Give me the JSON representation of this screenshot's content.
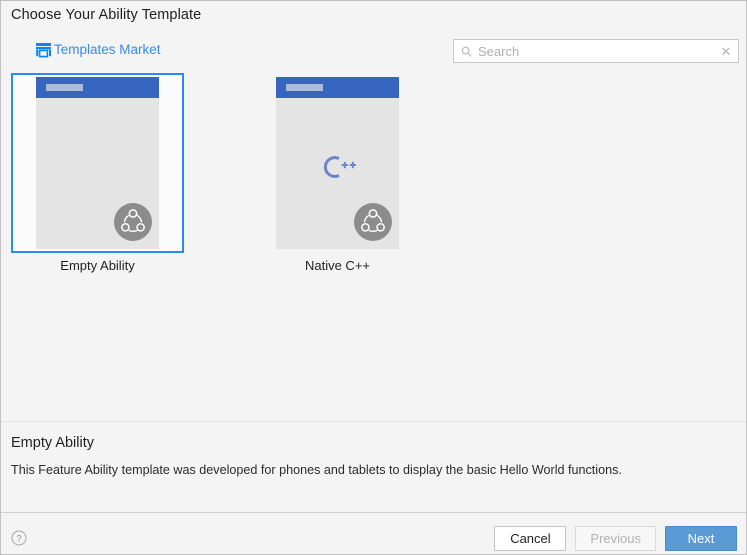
{
  "header": {
    "title": "Choose Your Ability Template",
    "templates_market_label": "Templates Market",
    "templates_market_icon": "storefront-icon"
  },
  "search": {
    "placeholder": "Search",
    "value": "",
    "search_icon": "search-icon",
    "clear_icon": "close-icon",
    "clear_glyph": "✕"
  },
  "templates": [
    {
      "label": "Empty Ability",
      "selected": true,
      "logo": "none",
      "badge_icon": "ability-badge-icon"
    },
    {
      "label": "Native C++",
      "selected": false,
      "logo": "cpp-logo",
      "badge_icon": "ability-badge-icon"
    }
  ],
  "description": {
    "title": "Empty Ability",
    "text": "This Feature Ability template was developed for phones and tablets to display the basic Hello World functions."
  },
  "footer": {
    "help_icon": "help-icon",
    "help_glyph": "?",
    "cancel_label": "Cancel",
    "previous_label": "Previous",
    "next_label": "Next"
  },
  "colors": {
    "accent_blue": "#3b8ae8",
    "selection_blue": "#2a8cf0",
    "thumb_header_blue": "#3765bf",
    "primary_button_blue": "#5b9bd5",
    "cpp_logo_blue": "#6b83c9",
    "badge_gray": "#8c8c8c",
    "background": "#f4f4f4"
  }
}
